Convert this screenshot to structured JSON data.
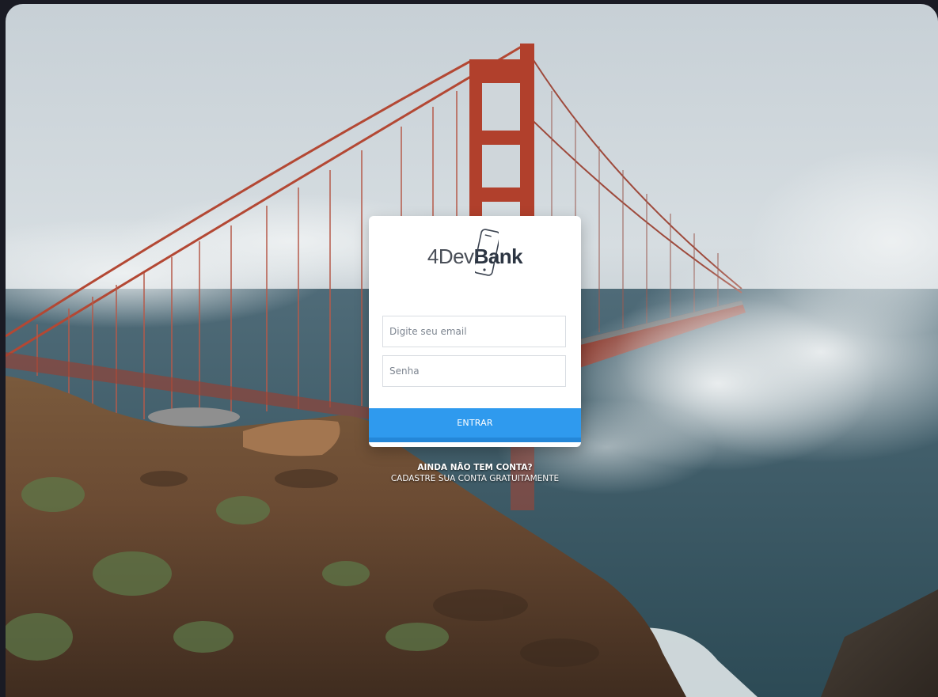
{
  "brand": {
    "prefix": "4Dev",
    "name": "Bank",
    "dark_color": "#2c3542",
    "light_color": "#4a4f58"
  },
  "login": {
    "email_placeholder": "Digite seu email",
    "email_value": "",
    "password_placeholder": "Senha",
    "password_value": "",
    "submit_label": "ENTRAR",
    "accent": "#2f9aee"
  },
  "signup": {
    "question": "AINDA NÃO TEM CONTA?",
    "link": "CADASTRE SUA CONTA GRATUITAMENTE"
  },
  "icons": {
    "logo": "phone-icon"
  }
}
